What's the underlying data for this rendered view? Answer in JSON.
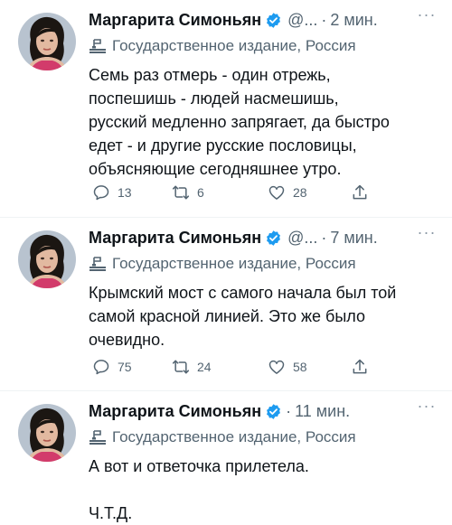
{
  "tweets": [
    {
      "author": "Маргарита Симоньян",
      "handle": "@...",
      "time": "2 мин.",
      "label": "Государственное издание, Россия",
      "text": "Семь раз отмерь - один отрежь,\nпоспешишь - людей насмешишь,\nрусский медленно запрягает, да быстро\nедет - и другие русские пословицы,\nобъясняющие сегодняшнее утро.",
      "replies": "13",
      "retweets": "6",
      "likes": "28"
    },
    {
      "author": "Маргарита Симоньян",
      "handle": "@...",
      "time": "7 мин.",
      "label": "Государственное издание, Россия",
      "text": "Крымский мост с самого начала был той\nсамой красной линией. Это же было\nочевидно.",
      "replies": "75",
      "retweets": "24",
      "likes": "58"
    },
    {
      "author": "Маргарита Симоньян",
      "handle": "",
      "time": "11 мин.",
      "label": "Государственное издание, Россия",
      "text": "А вот и ответочка прилетела.\n\nЧ.Т.Д."
    }
  ],
  "colors": {
    "verified": "#1d9bf0",
    "secondary_text": "#536471",
    "primary_text": "#0f1419",
    "separator": "#eff3f4"
  },
  "icons": {
    "verified": "verified-badge-icon",
    "label": "state-media-icon",
    "reply": "reply-icon",
    "retweet": "retweet-icon",
    "like": "heart-icon",
    "share": "share-icon",
    "more": "more-icon"
  }
}
